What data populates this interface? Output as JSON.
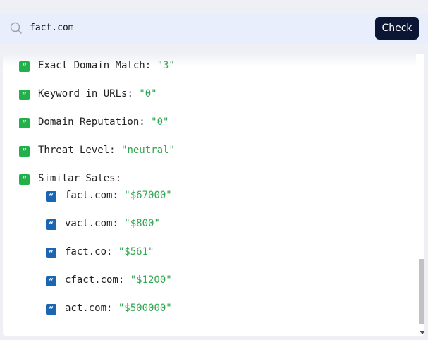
{
  "search": {
    "value": "fact.com",
    "button_label": "Check"
  },
  "results": [
    {
      "key": "Exact Domain Match",
      "value": "\"3\""
    },
    {
      "key": "Keyword in URLs",
      "value": "\"0\""
    },
    {
      "key": "Domain Reputation",
      "value": "\"0\""
    },
    {
      "key": "Threat Level",
      "value": "\"neutral\""
    },
    {
      "key": "Similar Sales",
      "value": ""
    }
  ],
  "similar_sales": [
    {
      "key": "fact.com",
      "value": "\"$67000\""
    },
    {
      "key": "vact.com",
      "value": "\"$800\""
    },
    {
      "key": "fact.co",
      "value": "\"$561\""
    },
    {
      "key": "cfact.com",
      "value": "\"$1200\""
    },
    {
      "key": "act.com",
      "value": "\"$500000\""
    }
  ],
  "separator": ": ",
  "icons": {
    "search": "search-icon",
    "quote": "quote-icon"
  },
  "colors": {
    "button_bg": "#0b1635",
    "top_level_icon": "#22b04b",
    "nested_icon": "#1b66b3",
    "value_text": "#2fa84f"
  }
}
